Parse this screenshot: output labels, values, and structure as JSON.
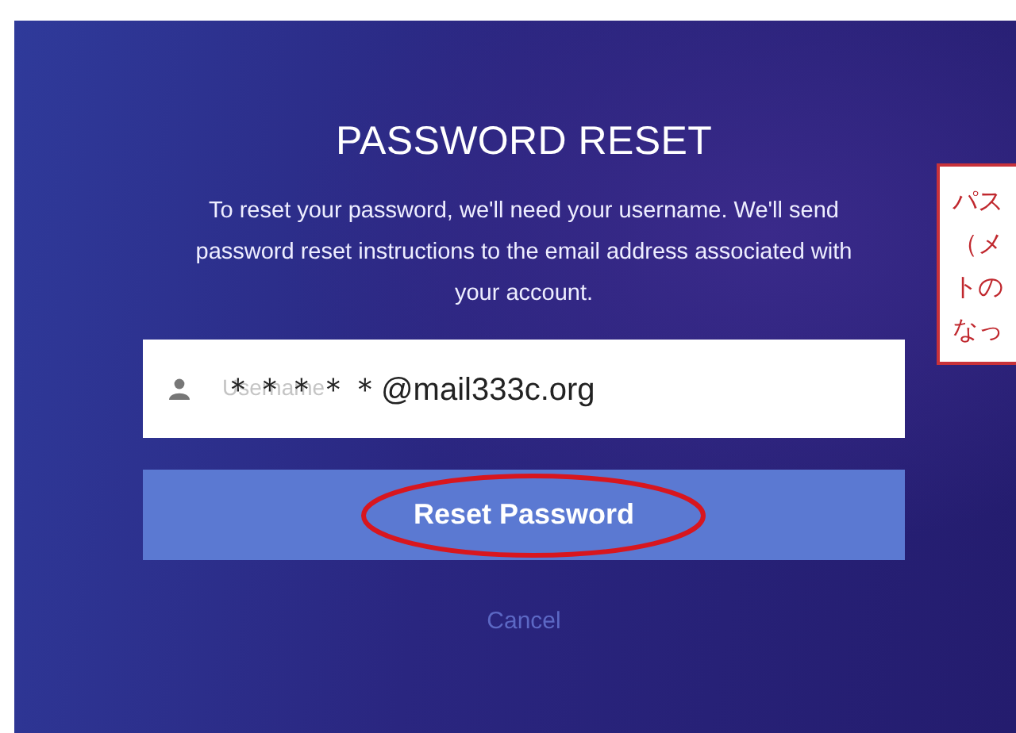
{
  "title": "PASSWORD RESET",
  "description": "To reset your password, we'll need your username. We'll send password reset instructions to the email address associated with your account.",
  "username_field": {
    "placeholder": "Username",
    "value": "＊＊＊＊＊@mail333c.org"
  },
  "reset_button": {
    "label": "Reset Password",
    "highlighted": true
  },
  "cancel_link": "Cancel",
  "callout": {
    "lines": [
      "パス",
      "（メ",
      "トの",
      "なっ"
    ]
  }
}
